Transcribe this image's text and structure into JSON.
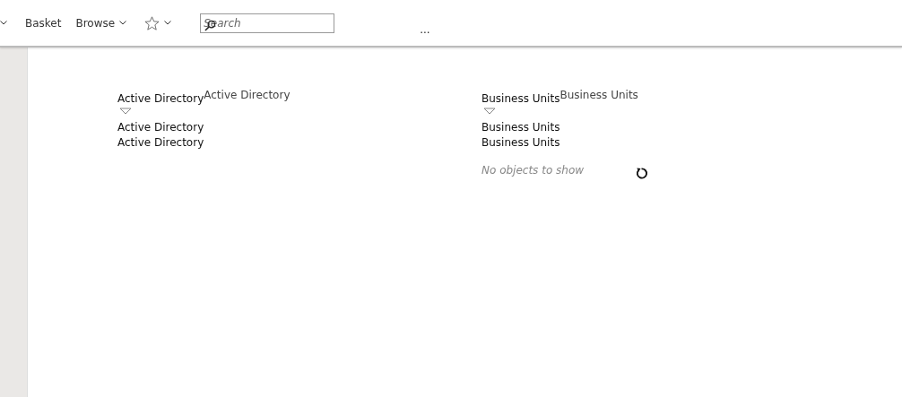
{
  "toolbar": {
    "items": [
      {
        "kind": "caret"
      },
      {
        "kind": "link",
        "label": "Basket"
      },
      {
        "kind": "dropdown",
        "label": "Browse"
      },
      {
        "kind": "favorites"
      }
    ],
    "search": {
      "placeholder": "Search"
    },
    "more": "..."
  },
  "panels": [
    {
      "title": "Active Directory",
      "subtitle": "Active Directory",
      "items": [
        "Active Directory",
        "Active Directory"
      ]
    },
    {
      "title": "Business Units",
      "subtitle": "Business Units",
      "items": [
        "Business Units",
        "Business Units"
      ],
      "empty_message": "No objects to show"
    }
  ]
}
